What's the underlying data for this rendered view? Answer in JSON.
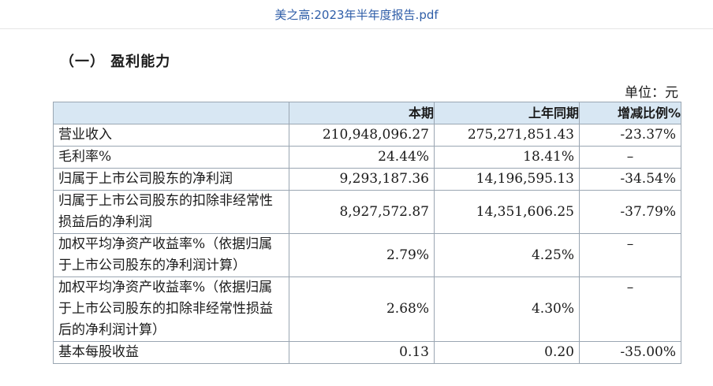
{
  "window": {
    "title": "美之高:2023年半年度报告.pdf"
  },
  "section": {
    "title": "（一） 盈利能力"
  },
  "unit_label": "单位：元",
  "table": {
    "headers": [
      "",
      "本期",
      "上年同期",
      "增减比例%"
    ],
    "rows": [
      {
        "label": "营业收入",
        "current": "210,948,096.27",
        "previous": "275,271,851.43",
        "change": "-23.37%"
      },
      {
        "label": "毛利率%",
        "current": "24.44%",
        "previous": "18.41%",
        "change": "–"
      },
      {
        "label": "归属于上市公司股东的净利润",
        "current": "9,293,187.36",
        "previous": "14,196,595.13",
        "change": "-34.54%"
      },
      {
        "label": "归属于上市公司股东的扣除非经常性损益后的净利润",
        "current": "8,927,572.87",
        "previous": "14,351,606.25",
        "change": "-37.79%"
      },
      {
        "label": "加权平均净资产收益率%（依据归属于上市公司股东的净利润计算）",
        "current": "2.79%",
        "previous": "4.25%",
        "change": "–"
      },
      {
        "label": "加权平均净资产收益率%（依据归属于上市公司股东的扣除非经常性损益后的净利润计算）",
        "current": "2.68%",
        "previous": "4.30%",
        "change": "–"
      },
      {
        "label": "基本每股收益",
        "current": "0.13",
        "previous": "0.20",
        "change": "-35.00%"
      }
    ]
  }
}
